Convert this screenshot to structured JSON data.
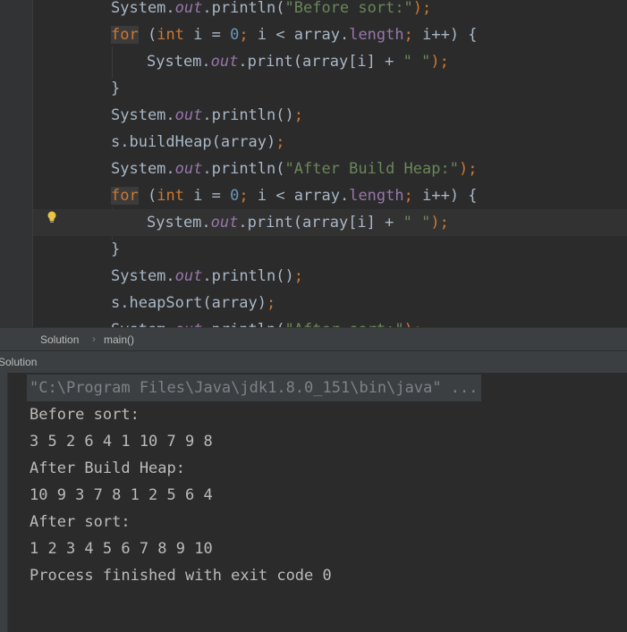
{
  "editor": {
    "lines": [
      {
        "id": "l0",
        "tokens": [
          [
            "System.",
            ""
          ],
          [
            "out",
            "fld"
          ],
          [
            ".println(",
            ""
          ],
          [
            "\"Before sort:\"",
            "str"
          ],
          [
            ");",
            "op"
          ]
        ]
      },
      {
        "id": "l1",
        "tokens": [
          [
            "for",
            "kw hl"
          ],
          [
            " (",
            ""
          ],
          [
            "int",
            "kw"
          ],
          [
            " i = ",
            ""
          ],
          [
            "0",
            "num"
          ],
          [
            "; ",
            "op"
          ],
          [
            "i < array.",
            ""
          ],
          [
            "length",
            "prop"
          ],
          [
            "; ",
            "op"
          ],
          [
            "i++) {",
            ""
          ]
        ]
      },
      {
        "id": "l2",
        "tokens": [
          [
            "System.",
            ""
          ],
          [
            "out",
            "fld"
          ],
          [
            ".print(array[i] + ",
            ""
          ],
          [
            "\" \"",
            "str"
          ],
          [
            ");",
            "op"
          ]
        ]
      },
      {
        "id": "l3",
        "tokens": [
          [
            "}",
            ""
          ]
        ]
      },
      {
        "id": "l4",
        "tokens": [
          [
            "System.",
            ""
          ],
          [
            "out",
            "fld"
          ],
          [
            ".println()",
            ""
          ],
          [
            ";",
            "op"
          ]
        ]
      },
      {
        "id": "l5",
        "tokens": [
          [
            "s.buildHeap(array)",
            ""
          ],
          [
            ";",
            "op"
          ]
        ]
      },
      {
        "id": "l6",
        "tokens": [
          [
            "System.",
            ""
          ],
          [
            "out",
            "fld"
          ],
          [
            ".println(",
            ""
          ],
          [
            "\"After Build Heap:\"",
            "str"
          ],
          [
            ");",
            "op"
          ]
        ]
      },
      {
        "id": "l7",
        "tokens": [
          [
            "for",
            "kw hl"
          ],
          [
            " (",
            ""
          ],
          [
            "int",
            "kw"
          ],
          [
            " i = ",
            ""
          ],
          [
            "0",
            "num"
          ],
          [
            "; ",
            "op"
          ],
          [
            "i < array.",
            ""
          ],
          [
            "length",
            "prop"
          ],
          [
            "; ",
            "op"
          ],
          [
            "i++) {",
            ""
          ]
        ]
      },
      {
        "id": "l8",
        "tokens": [
          [
            "System.",
            ""
          ],
          [
            "out",
            "fld"
          ],
          [
            ".print(array[i] + ",
            ""
          ],
          [
            "\" \"",
            "str"
          ],
          [
            ");",
            "op"
          ]
        ]
      },
      {
        "id": "l9",
        "tokens": [
          [
            "}",
            ""
          ]
        ]
      },
      {
        "id": "l10",
        "tokens": [
          [
            "System.",
            ""
          ],
          [
            "out",
            "fld"
          ],
          [
            ".println()",
            ""
          ],
          [
            ";",
            "op"
          ]
        ]
      },
      {
        "id": "l11",
        "tokens": [
          [
            "s.heapSort(array)",
            ""
          ],
          [
            ";",
            "op"
          ]
        ]
      },
      {
        "id": "l12",
        "tokens": [
          [
            "System.",
            ""
          ],
          [
            "out",
            "fld"
          ],
          [
            ".println(",
            ""
          ],
          [
            "\"After sort:\"",
            "str"
          ],
          [
            ");",
            "op"
          ]
        ]
      }
    ],
    "intention_icon": "lightbulb-icon"
  },
  "breadcrumb": {
    "class_name": "Solution",
    "separator": "›",
    "method_name": "main()"
  },
  "run_panel": {
    "title": "Solution",
    "command": "\"C:\\Program Files\\Java\\jdk1.8.0_151\\bin\\java\" ...",
    "output": [
      "Before sort:",
      "3 5 2 6 4 1 10 7 9 8",
      "After Build Heap:",
      "10 9 3 7 8 1 2 5 6 4",
      "After sort:",
      "1 2 3 4 5 6 7 8 9 10",
      "Process finished with exit code 0"
    ]
  },
  "colors": {
    "editor_bg": "#2b2b2b",
    "keyword": "#cc7832",
    "string": "#6a8759",
    "number": "#6897bb",
    "field": "#9876aa",
    "text": "#a9b7c6"
  }
}
